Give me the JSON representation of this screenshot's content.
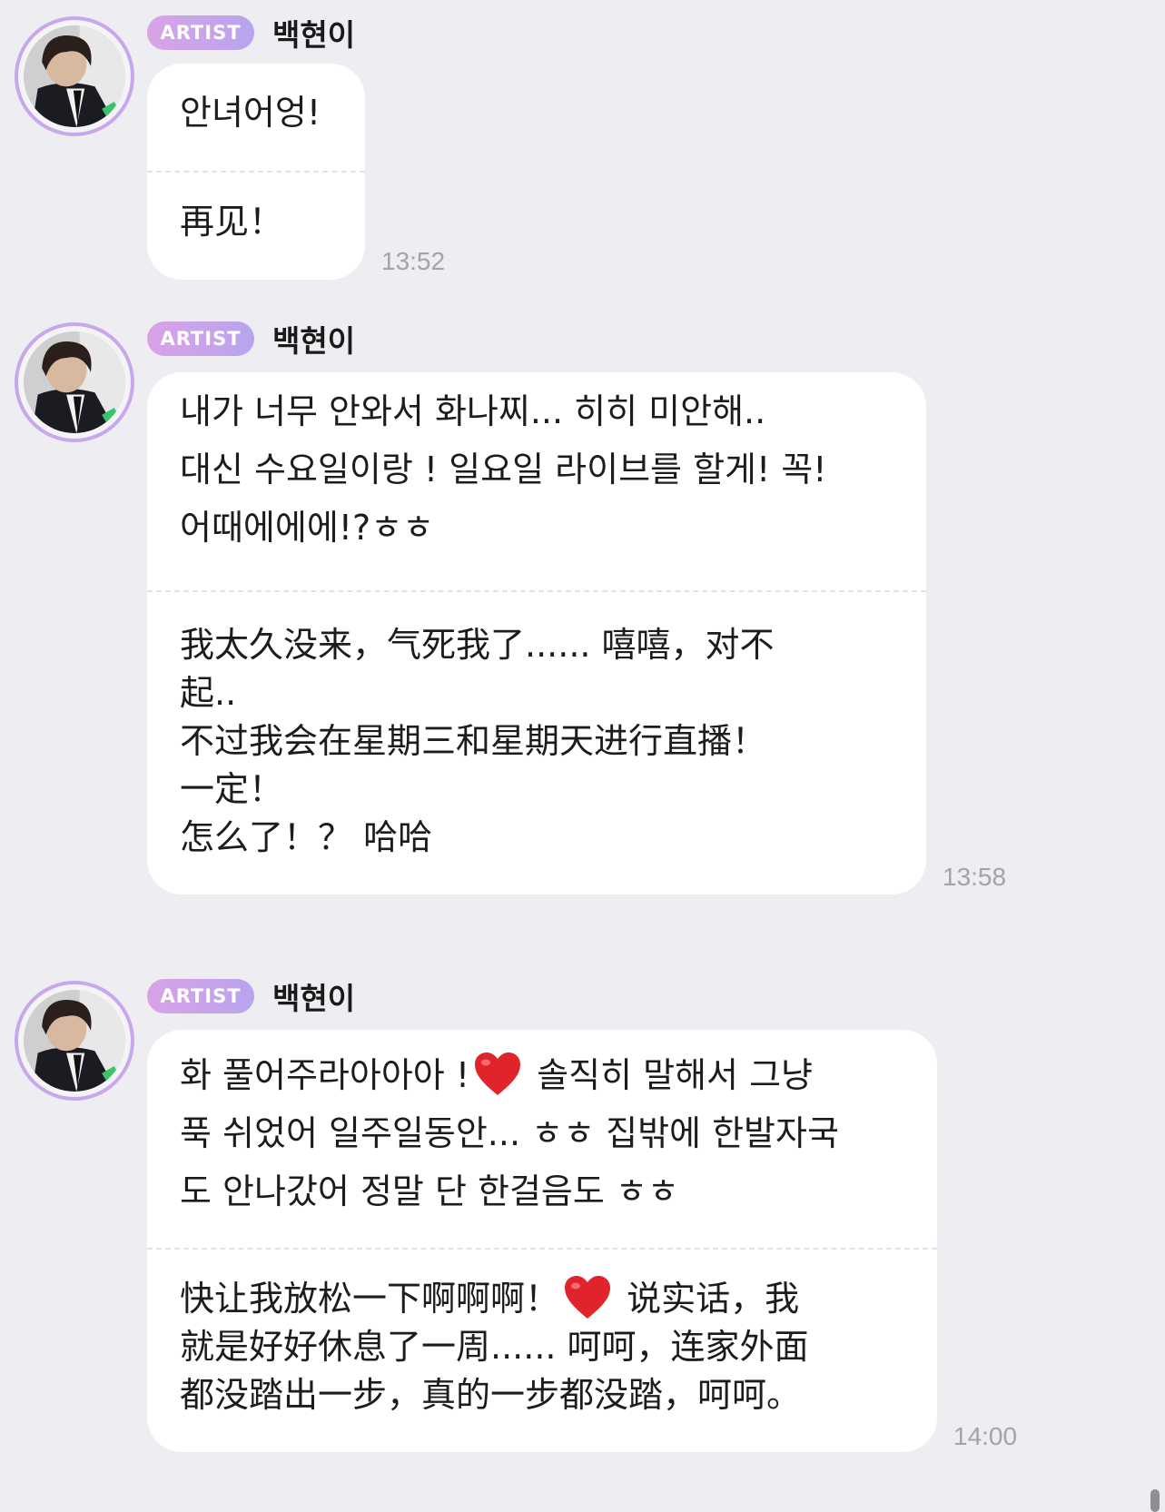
{
  "messages": [
    {
      "badge": "ARTIST",
      "sender": "백현이",
      "time": "13:52",
      "korean": [
        "안녀어엉!"
      ],
      "chinese": [
        "再见！"
      ]
    },
    {
      "badge": "ARTIST",
      "sender": "백현이",
      "time": "13:58",
      "korean": [
        "내가 너무 안와서 화나찌... 히히 미안해..",
        "대신 수요일이랑 ! 일요일 라이브를 할게! 꼭!",
        "어때에에에!?ㅎㅎ"
      ],
      "chinese": [
        "我太久没来，气死我了...... 嘻嘻，对不",
        "起..",
        "不过我会在星期三和星期天进行直播！",
        "一定！",
        "怎么了！？ 哈哈"
      ]
    },
    {
      "badge": "ARTIST",
      "sender": "백현이",
      "time": "14:00",
      "korean": [
        {
          "before": "화 풀어주라아아아 !",
          "after": " 솔직히 말해서 그냥"
        },
        "푹 쉬었어 일주일동안... ㅎㅎ 집밖에 한발자국",
        "도 안나갔어 정말 단 한걸음도 ㅎㅎ"
      ],
      "chinese": [
        {
          "before": "快让我放松一下啊啊啊！",
          "after": " 说实话，我"
        },
        "就是好好休息了一周...... 呵呵，连家外面",
        "都没踏出一步，真的一步都没踏，呵呵。"
      ]
    }
  ],
  "icons": {
    "heart": "red-heart-emoji",
    "avatar": "profile-photo"
  },
  "colors": {
    "background": "#ededf2",
    "bubble": "#ffffff",
    "badge_gradient_start": "#d9a3e6",
    "badge_gradient_end": "#b8a4ee",
    "avatar_ring": "#c8a7ec",
    "timestamp": "#a4a4a8",
    "heart": "#e0242c"
  }
}
